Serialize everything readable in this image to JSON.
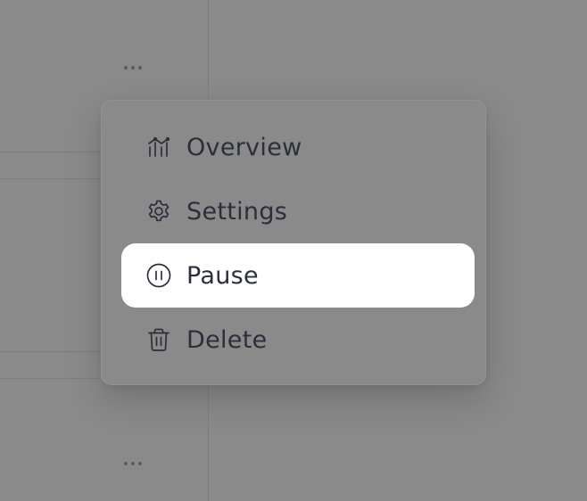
{
  "menu": {
    "items": [
      {
        "label": "Overview",
        "icon": "chart-icon",
        "active": false
      },
      {
        "label": "Settings",
        "icon": "gear-icon",
        "active": false
      },
      {
        "label": "Pause",
        "icon": "pause-icon",
        "active": true
      },
      {
        "label": "Delete",
        "icon": "trash-icon",
        "active": false
      }
    ]
  },
  "colors": {
    "overlay": "#8a8a8a",
    "active_item_bg": "#ffffff",
    "text": "#2b2f3a"
  }
}
